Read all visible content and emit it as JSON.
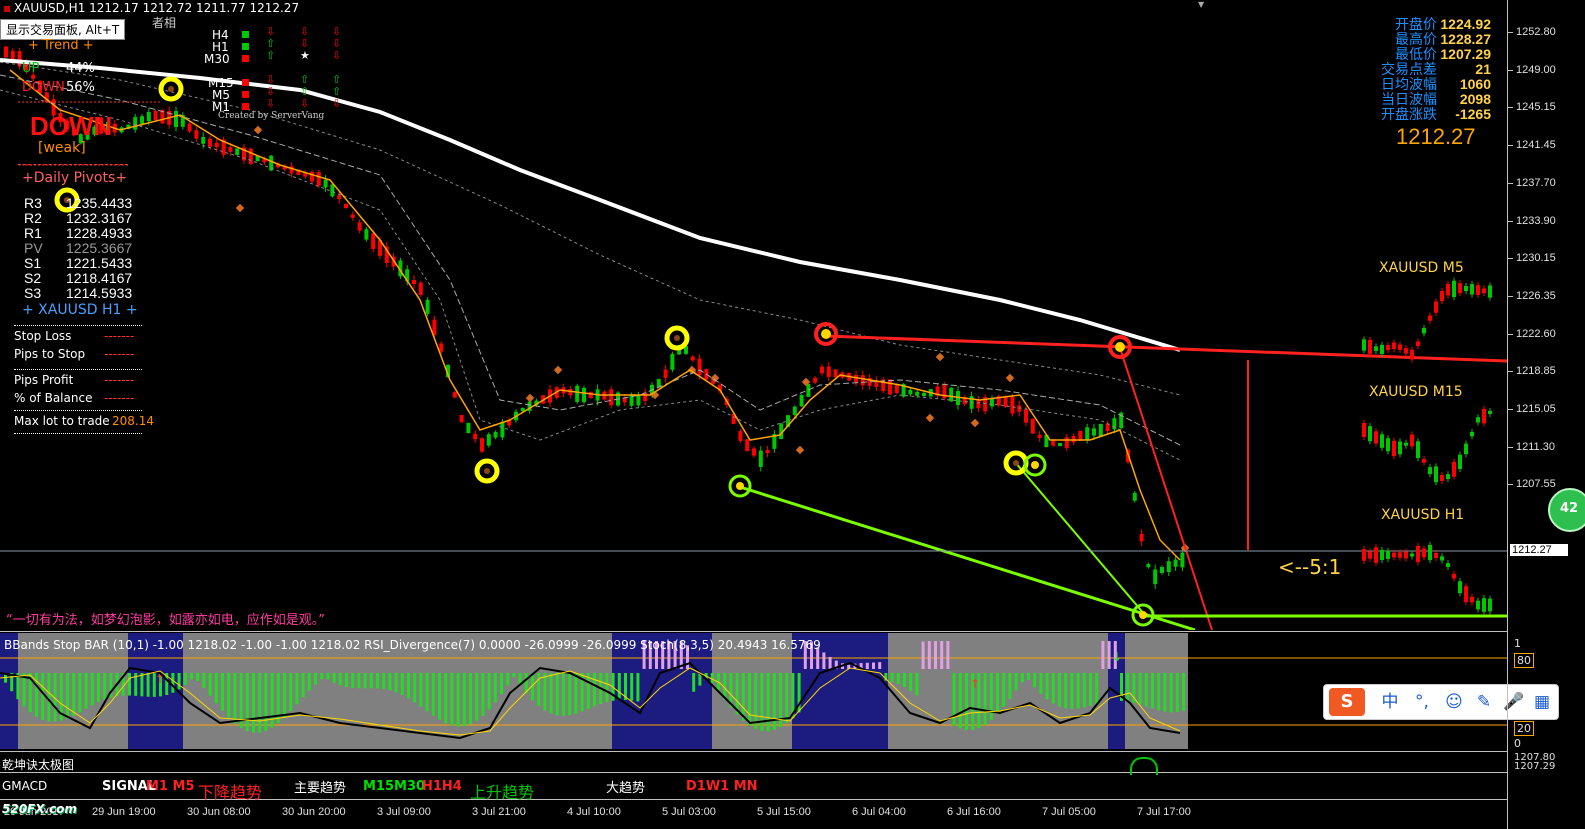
{
  "header": {
    "symbol_line": "XAUUSD,H1  1212.17 1212.72 1211.77 1212.27",
    "tooltip": "显示交易面板, Alt+T",
    "watermark_fragment": "者相"
  },
  "trend_box": {
    "title": "Trend",
    "up_label": "UP",
    "up_pct": "44%",
    "down_label": "DOWN",
    "down_pct": "56%",
    "signal": "DOWN",
    "strength": "[weak]",
    "credit": "Created by ServerVang"
  },
  "timeframes": {
    "rows1": [
      "H4",
      "H1",
      "M30"
    ],
    "rows2": [
      "M15",
      "M5",
      "M1"
    ]
  },
  "pivots": {
    "title": "+Daily Pivots+",
    "rows": [
      {
        "k": "R3",
        "v": "1235.4433"
      },
      {
        "k": "R2",
        "v": "1232.3167"
      },
      {
        "k": "R1",
        "v": "1228.4933"
      },
      {
        "k": "PV",
        "v": "1225.3667"
      },
      {
        "k": "S1",
        "v": "1221.5433"
      },
      {
        "k": "S2",
        "v": "1218.4167"
      },
      {
        "k": "S3",
        "v": "1214.5933"
      }
    ],
    "footer": "+  XAUUSD  H1  +"
  },
  "trade_panel": {
    "stop_loss": "Stop Loss",
    "pips_to_stop": "Pips to Stop",
    "pips_profit": "Pips Profit",
    "balance": "% of Balance",
    "max_lot": "Max lot to trade",
    "max_lot_value": "208.14",
    "dash": "-------"
  },
  "stats": {
    "rows": [
      {
        "k": "开盘价",
        "v": "1224.92"
      },
      {
        "k": "最高价",
        "v": "1228.27"
      },
      {
        "k": "最低价",
        "v": "1207.29"
      },
      {
        "k": "交易点差",
        "v": "21"
      },
      {
        "k": "日均波幅",
        "v": "1060"
      },
      {
        "k": "当日波幅",
        "v": "2098"
      },
      {
        "k": "开盘涨跌",
        "v": "-1265"
      }
    ],
    "price": "1212.27"
  },
  "mini_charts": {
    "m5": "XAUUSD M5",
    "m15": "XAUUSD M15",
    "h1": "XAUUSD H1",
    "ratio": "<--5:1"
  },
  "quote": "“一切有为法，如梦幻泡影，如露亦如电，应作如是观。”",
  "price_axis": {
    "labels": [
      "1252.80",
      "1249.00",
      "1245.15",
      "1241.45",
      "1237.70",
      "1233.90",
      "1230.15",
      "1226.35",
      "1222.60",
      "1218.85",
      "1215.05",
      "1211.30",
      "1207.55"
    ],
    "current": "1212.27",
    "ind_labels": [
      "1",
      "80",
      "20",
      "0"
    ],
    "bottom_labels": [
      "1207.80",
      "1207.29"
    ]
  },
  "indicator_panel": {
    "title": "BBands Stop BAR (10,1) -1.00 1218.02 -1.00 -1.00 1218.02  RSI_Divergence(7) 0.0000 -26.0999 -26.0999  Stoch(8,3,5) 20.4943 16.5769"
  },
  "bottom_panel": {
    "taiji": "乾坤诀太极图",
    "gmacd": "GMACD",
    "signal_label": "SIGNAL",
    "m1m5": "M1 M5",
    "down_trend": "下降趋势",
    "main_trend": "主要趋势",
    "m15_h4": "M15M30",
    "h1_h4": "H1H4",
    "up_trend": "上升趋势",
    "big_trend": "大趋势",
    "d1w1mn": "D1W1 MN"
  },
  "dates": [
    "29 Jun 2017",
    "29 Jun 19:00",
    "30 Jun 08:00",
    "30 Jun 20:00",
    "3 Jul 09:00",
    "3 Jul 21:00",
    "4 Jul 10:00",
    "5 Jul 03:00",
    "5 Jul 15:00",
    "6 Jul 04:00",
    "6 Jul 16:00",
    "7 Jul 05:00",
    "7 Jul 17:00"
  ],
  "logo": "520FX.com",
  "ime": {
    "chinese": "中",
    "punct": "°,",
    "emoji": "☺",
    "pen": "✎",
    "mic": "🎤",
    "grid": "▦"
  },
  "badge": "42",
  "colors": {
    "bull": "#00c800",
    "bear": "#ff0000",
    "ma_white": "#ffffff",
    "ma_orange": "#ffa500",
    "accent_yellow": "#ffff00",
    "trend_line_green": "#7cfc00",
    "trend_line_red": "#ff2020",
    "stats_blue": "#1e90ff",
    "stats_gold": "#ffd24a",
    "navy": "#1c1c80",
    "gray": "#808080"
  }
}
